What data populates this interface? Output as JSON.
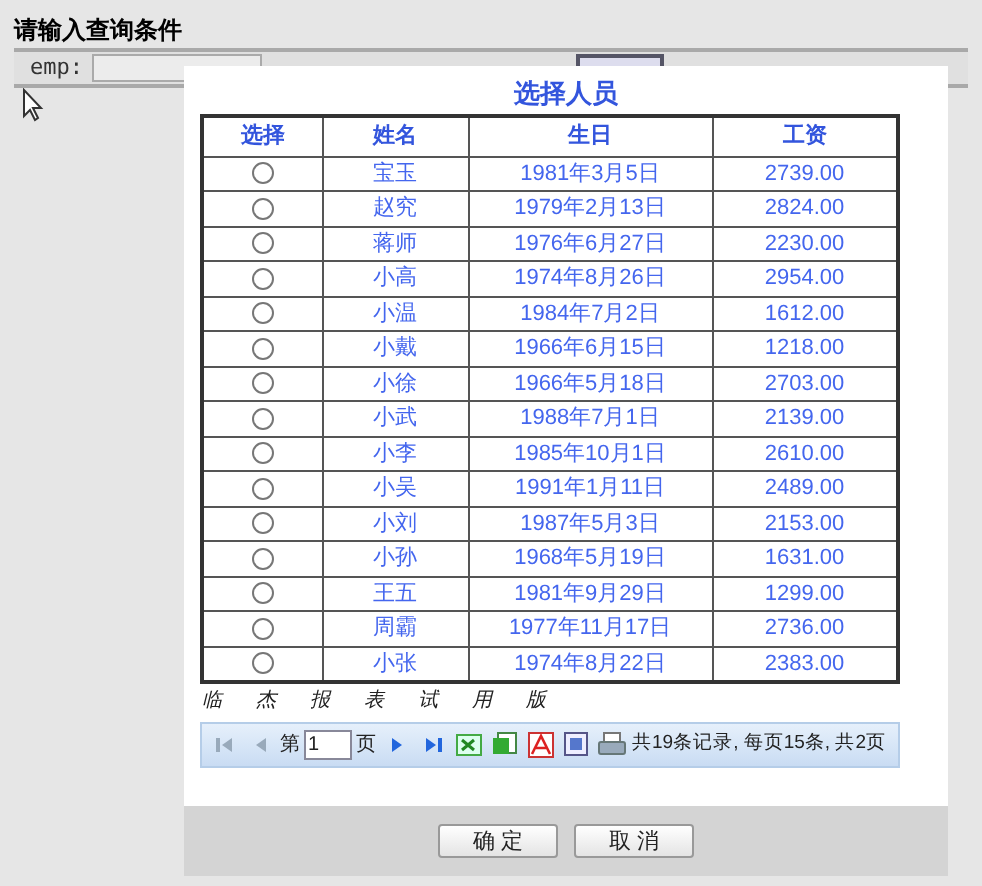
{
  "page_title": "请输入查询条件",
  "query": {
    "label": "emp:"
  },
  "dialog": {
    "title": "选择人员",
    "columns": [
      "选择",
      "姓名",
      "生日",
      "工资"
    ],
    "rows": [
      {
        "selected": false,
        "name": "宝玉",
        "birthday": "1981年3月5日",
        "salary": "2739.00"
      },
      {
        "selected": false,
        "name": "赵究",
        "birthday": "1979年2月13日",
        "salary": "2824.00"
      },
      {
        "selected": false,
        "name": "蒋师",
        "birthday": "1976年6月27日",
        "salary": "2230.00"
      },
      {
        "selected": false,
        "name": "小高",
        "birthday": "1974年8月26日",
        "salary": "2954.00"
      },
      {
        "selected": false,
        "name": "小温",
        "birthday": "1984年7月2日",
        "salary": "1612.00"
      },
      {
        "selected": false,
        "name": "小戴",
        "birthday": "1966年6月15日",
        "salary": "1218.00"
      },
      {
        "selected": false,
        "name": "小徐",
        "birthday": "1966年5月18日",
        "salary": "2703.00"
      },
      {
        "selected": false,
        "name": "小武",
        "birthday": "1988年7月1日",
        "salary": "2139.00"
      },
      {
        "selected": false,
        "name": "小李",
        "birthday": "1985年10月1日",
        "salary": "2610.00"
      },
      {
        "selected": false,
        "name": "小吴",
        "birthday": "1991年1月11日",
        "salary": "2489.00"
      },
      {
        "selected": false,
        "name": "小刘",
        "birthday": "1987年5月3日",
        "salary": "2153.00"
      },
      {
        "selected": false,
        "name": "小孙",
        "birthday": "1968年5月19日",
        "salary": "1631.00"
      },
      {
        "selected": false,
        "name": "王五",
        "birthday": "1981年9月29日",
        "salary": "1299.00"
      },
      {
        "selected": false,
        "name": "周霸",
        "birthday": "1977年11月17日",
        "salary": "2736.00"
      },
      {
        "selected": false,
        "name": "小张",
        "birthday": "1974年8月22日",
        "salary": "2383.00"
      }
    ],
    "trial_note": [
      "临",
      "杰",
      "报",
      "表",
      "试",
      "用",
      "版"
    ],
    "pager": {
      "page_prefix": "第",
      "page": "1",
      "page_suffix": "页",
      "summary": "共19条记录, 每页15条, 共2页"
    },
    "buttons": [
      "确 定",
      "取 消"
    ]
  }
}
